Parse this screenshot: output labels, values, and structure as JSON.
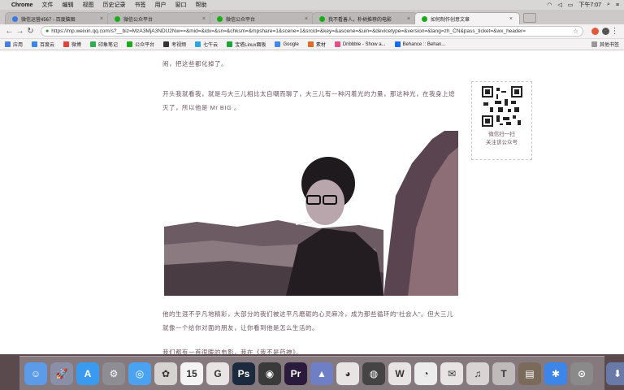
{
  "menubar": {
    "app_name": "Chrome",
    "menus": [
      "文件",
      "编辑",
      "视图",
      "历史记录",
      "书签",
      "用户",
      "窗口",
      "帮助"
    ],
    "clock": "下午7:07"
  },
  "tabs": [
    {
      "label": "微信运营4567 - 百度脑图",
      "color": "#3b7be0"
    },
    {
      "label": "微信公众平台",
      "color": "#1aad19"
    },
    {
      "label": "微信公众平台",
      "color": "#1aad19"
    },
    {
      "label": "我不看善人，朴树推荐的电影",
      "color": "#1aad19"
    },
    {
      "label": "如何制作创意文章",
      "color": "#1aad19",
      "active": true
    }
  ],
  "toolbar": {
    "url": "https://mp.weixin.qq.com/s?__biz=MzA3MjA3NDU2Nw==&mid=&idx=&sn=&chksm=&mpshare=1&scene=1&srcid=&key=&ascene=&uin=&devicetype=&version=&lang=zh_CN&pass_ticket=&wx_header=",
    "back": "←",
    "forward": "→",
    "reload": "↻",
    "star": "☆"
  },
  "bookmarks": [
    {
      "label": "应用",
      "color": "#4a7fe0"
    },
    {
      "label": "百度云",
      "color": "#3b86e8"
    },
    {
      "label": "微博",
      "color": "#e0453a"
    },
    {
      "label": "印象笔记",
      "color": "#2db14e"
    },
    {
      "label": "公众平台",
      "color": "#1aad19"
    },
    {
      "label": "考视频",
      "color": "#333333"
    },
    {
      "label": "七牛云",
      "color": "#2aa7e0"
    },
    {
      "label": "宝塔Linux面板",
      "color": "#20a53a"
    },
    {
      "label": "Google",
      "color": "#4285f4"
    },
    {
      "label": "素材",
      "color": "#e06c2a"
    },
    {
      "label": "Dribbble - Show a...",
      "color": "#ea4c89"
    },
    {
      "label": "Behance :: Behan...",
      "color": "#1769ff"
    }
  ],
  "bookmarks_other": "其他书签",
  "article": {
    "p0": "闹，把这些都化掉了。",
    "p1": "开头我就看我，就是与大三儿相比太自嘲而聊了，大三儿有一种闪着光的力量，那这种光，在我身上熄灭了，所以他是 Mr BIG 。",
    "p2": "他的生涯不乎凡地精彩，大部分的我们被这平凡磨砺的心灵麻冷，成为那些循环的“社会人”。但大三儿就像一个给你对面的朋友，让你看到他是怎么生活的。",
    "p3": "我们都有一首很暖的电影，我在《我不是药神》。"
  },
  "qr": {
    "line1": "微信扫一扫",
    "line2": "关注该公众号"
  },
  "dock": [
    {
      "name": "finder",
      "color": "#5b9be8",
      "glyph": "☺"
    },
    {
      "name": "launchpad",
      "color": "#8a8fa8",
      "glyph": "🚀"
    },
    {
      "name": "app-store",
      "color": "#3a9af0",
      "glyph": "A"
    },
    {
      "name": "system-preferences",
      "color": "#8d8d93",
      "glyph": "⚙"
    },
    {
      "name": "safari",
      "color": "#4aa3f0",
      "glyph": "◎"
    },
    {
      "name": "photos",
      "color": "#d6d2cf",
      "glyph": "✿"
    },
    {
      "name": "calendar",
      "color": "#f4f4f4",
      "glyph": "15"
    },
    {
      "name": "grammarly",
      "color": "#e8e4e4",
      "glyph": "G"
    },
    {
      "name": "photoshop",
      "color": "#1b2a3f",
      "glyph": "Ps"
    },
    {
      "name": "davinci",
      "color": "#3a3a3a",
      "glyph": "◉"
    },
    {
      "name": "premiere",
      "color": "#2a1a3c",
      "glyph": "Pr"
    },
    {
      "name": "keynote",
      "color": "#6f7fc6",
      "glyph": "▲"
    },
    {
      "name": "chrome",
      "color": "#e8e4e4",
      "glyph": "◕"
    },
    {
      "name": "screen-recorder",
      "color": "#444",
      "glyph": "◍"
    },
    {
      "name": "wps",
      "color": "#e8e4e4",
      "glyph": "W"
    },
    {
      "name": "qq",
      "color": "#ececec",
      "glyph": "◔"
    },
    {
      "name": "wechat",
      "color": "#e8e4e4",
      "glyph": "✉"
    },
    {
      "name": "itunes",
      "color": "#d8d4d4",
      "glyph": "♫"
    },
    {
      "name": "typora",
      "color": "#bfbbbb",
      "glyph": "T"
    },
    {
      "name": "notes",
      "color": "#7a6a5a",
      "glyph": "▤"
    },
    {
      "name": "baidu-netdisk",
      "color": "#3b86e8",
      "glyph": "✱"
    },
    {
      "name": "disk-utility",
      "color": "#8a8a8a",
      "glyph": "⊙"
    },
    {
      "name": "downloads",
      "color": "#6a7aa8",
      "glyph": "⬇"
    },
    {
      "name": "trash",
      "color": "#c8c8c8",
      "glyph": "🗑"
    }
  ]
}
